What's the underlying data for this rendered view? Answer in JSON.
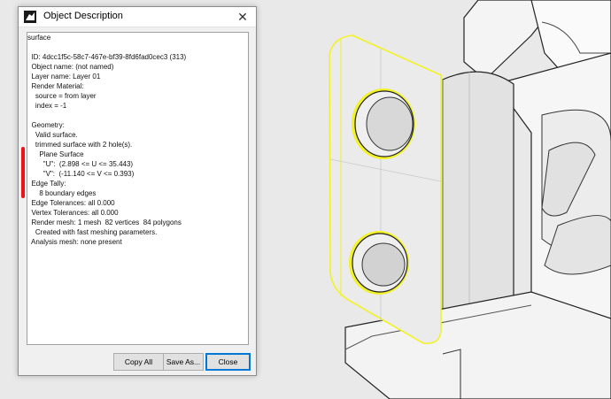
{
  "dialog": {
    "title": "Object Description",
    "close_glyph": "✕",
    "description_lines": [
      "surface",
      "",
      "  ID: 4dcc1f5c-58c7-467e-bf39-8fd6fad0cec3 (313)",
      "  Object name: (not named)",
      "  Layer name: Layer 01",
      "  Render Material:",
      "    source = from layer",
      "    index = -1",
      "",
      "  Geometry:",
      "    Valid surface.",
      "    trimmed surface with 2 hole(s).",
      "      Plane Surface",
      "        \"U\":  (2.898 <= U <= 35.443)",
      "        \"V\":  (-11.140 <= V <= 0.393)",
      "  Edge Tally:",
      "      8 boundary edges",
      "  Edge Tolerances: all 0.000",
      "  Vertex Tolerances: all 0.000",
      "  Render mesh: 1 mesh  82 vertices  84 polygons",
      "    Created with fast meshing parameters.",
      "  Analysis mesh: none present"
    ],
    "buttons": {
      "copy_all": "Copy All",
      "save_as": "Save As...",
      "close": "Close"
    }
  },
  "colors": {
    "selection_highlight": "#f2f226",
    "scroll_marker": "#e8161c",
    "viewport_background": "#e9e9e9"
  }
}
